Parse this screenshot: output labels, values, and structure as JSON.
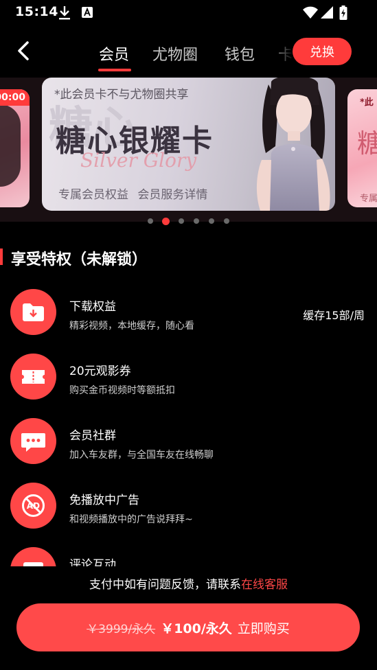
{
  "status_bar": {
    "time": "15:14",
    "icons": [
      "download-icon",
      "a-icon",
      "wifi-icon",
      "signal-icon",
      "battery-icon"
    ]
  },
  "header": {
    "tabs": [
      {
        "label": "会员",
        "active": true
      },
      {
        "label": "尤物圈",
        "active": false
      },
      {
        "label": "钱包",
        "active": false
      },
      {
        "label": "卡",
        "active": false
      }
    ],
    "redeem_label": "兑换"
  },
  "carousel": {
    "left_card": {
      "timer": "00:00"
    },
    "main_card": {
      "note": "*此会员卡不与尤物圈共享",
      "title": "糖心银耀卡",
      "script": "Silver Glory",
      "link_benefits": "专属会员权益",
      "link_details": "会员服务详情"
    },
    "right_card": {
      "note": "*此",
      "title": "糖",
      "sub": "专属"
    },
    "dots_count": 6,
    "active_dot": 1
  },
  "section": {
    "title": "享受特权（未解锁）"
  },
  "privileges": [
    {
      "icon": "download-folder-icon",
      "name": "下载权益",
      "desc": "精彩视频，本地缓存，随心看",
      "extra": "缓存15部/周"
    },
    {
      "icon": "ticket-icon",
      "name": "20元观影券",
      "desc": "购买金币视频时等额抵扣",
      "extra": ""
    },
    {
      "icon": "chat-bubble-icon",
      "name": "会员社群",
      "desc": "加入车友群，与全国车友在线畅聊",
      "extra": ""
    },
    {
      "icon": "no-ads-icon",
      "name": "免播放中广告",
      "desc": "和视频播放中的广告说拜拜~",
      "extra": ""
    },
    {
      "icon": "comment-icon",
      "name": "评论互动",
      "desc": "",
      "extra": ""
    }
  ],
  "footer": {
    "help_text": "支付中如有问题反馈，请联系",
    "help_link": "在线客服",
    "old_price": "￥3999/永久",
    "new_price": "￥100/永久",
    "buy_label": "立即购买"
  },
  "colors": {
    "accent": "#ff4747",
    "background": "#000000",
    "carousel_bg": "#190f12"
  }
}
